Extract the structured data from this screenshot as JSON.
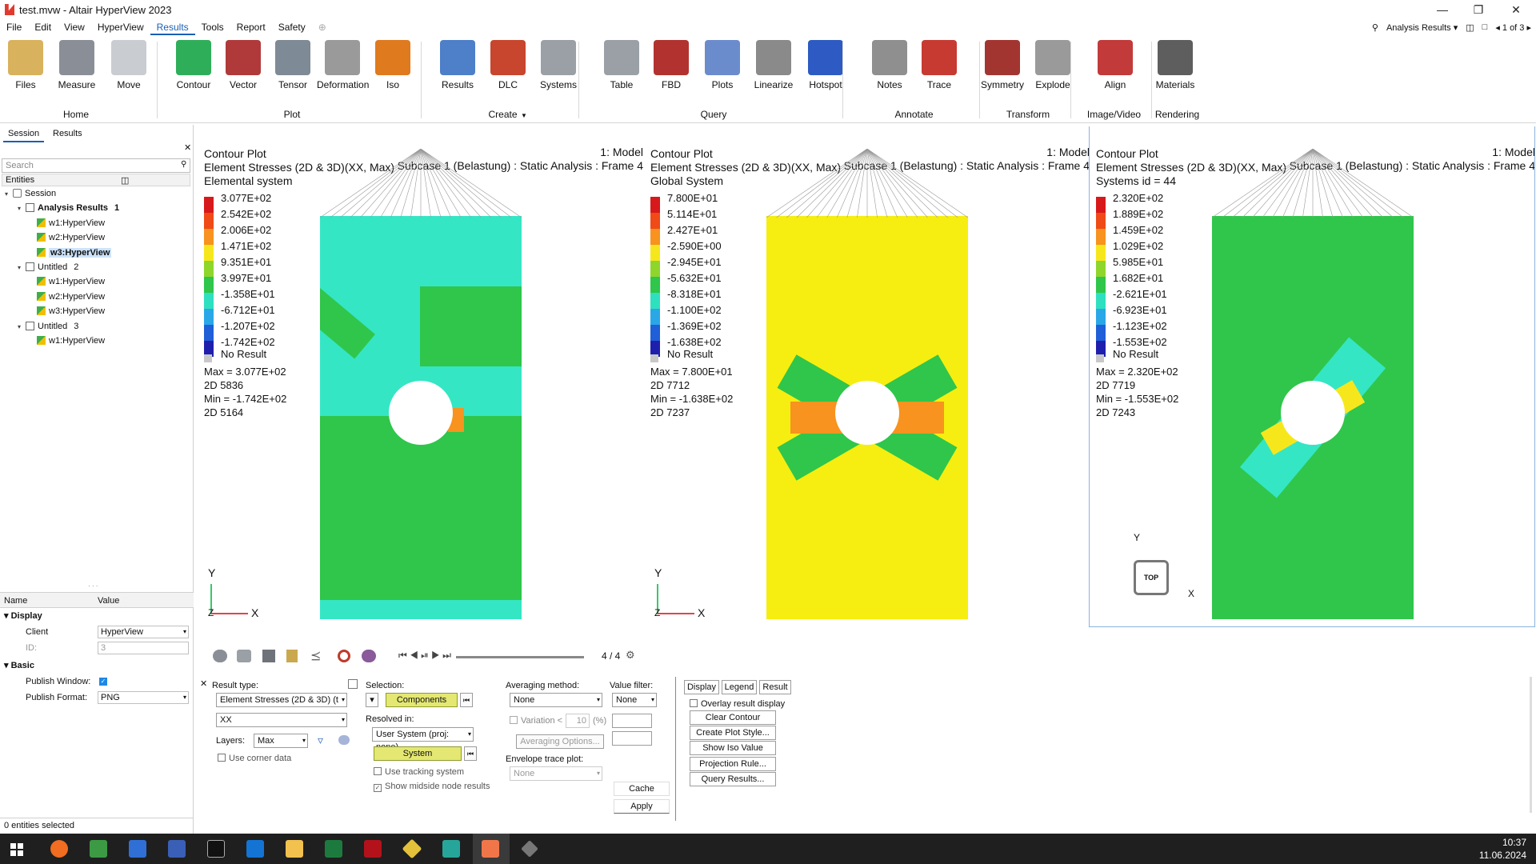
{
  "window": {
    "title": "test.mvw - Altair HyperView 2023"
  },
  "menu": [
    "File",
    "Edit",
    "View",
    "HyperView",
    "Results",
    "Tools",
    "Report",
    "Safety"
  ],
  "menu_active": "Results",
  "menu_right": {
    "page_select": "Analysis Results",
    "page_count": "1 of 3"
  },
  "ribbon": {
    "tools": [
      {
        "label": "Files",
        "icon": "folder-icon",
        "color": "#d8b25c"
      },
      {
        "label": "Measure",
        "icon": "measure-icon",
        "color": "#8a8f97"
      },
      {
        "label": "Move",
        "icon": "move-icon",
        "color": "#c9ccd1"
      },
      {
        "label": "Contour",
        "icon": "contour-icon",
        "color": "#2fae5a"
      },
      {
        "label": "Vector",
        "icon": "vector-icon",
        "color": "#b03a3a"
      },
      {
        "label": "Tensor",
        "icon": "tensor-icon",
        "color": "#7e8a95"
      },
      {
        "label": "Deformation",
        "icon": "deformation-icon",
        "color": "#9a9a9a"
      },
      {
        "label": "Iso",
        "icon": "iso-icon",
        "color": "#e07a1e"
      },
      {
        "label": "Results",
        "icon": "results-icon",
        "color": "#4e7fc9"
      },
      {
        "label": "DLC",
        "icon": "dlc-icon",
        "color": "#c7462d"
      },
      {
        "label": "Systems",
        "icon": "systems-icon",
        "color": "#9aa0a6"
      },
      {
        "label": "Table",
        "icon": "table-icon",
        "color": "#9aa0a6"
      },
      {
        "label": "FBD",
        "icon": "fbd-icon",
        "color": "#b2322f"
      },
      {
        "label": "Plots",
        "icon": "plots-icon",
        "color": "#6b8ccc"
      },
      {
        "label": "Linearize",
        "icon": "linearize-icon",
        "color": "#8a8a8a"
      },
      {
        "label": "Hotspot",
        "icon": "hotspot-icon",
        "color": "#2d5bc3"
      },
      {
        "label": "Notes",
        "icon": "notes-icon",
        "color": "#8f8f8f"
      },
      {
        "label": "Trace",
        "icon": "trace-icon",
        "color": "#c73a32"
      },
      {
        "label": "Symmetry",
        "icon": "symmetry-icon",
        "color": "#a33530"
      },
      {
        "label": "Explode",
        "icon": "explode-icon",
        "color": "#9a9a9a"
      },
      {
        "label": "Align",
        "icon": "align-icon",
        "color": "#c23a3a"
      },
      {
        "label": "Materials",
        "icon": "materials-icon",
        "color": "#5e5e5e"
      }
    ],
    "groups": [
      "Home",
      "Plot",
      "Create",
      "Query",
      "Annotate",
      "Transform",
      "Image/Video",
      "Rendering"
    ]
  },
  "left": {
    "tabs": [
      "Session",
      "Results"
    ],
    "search_placeholder": "Search",
    "entities_label": "Entities",
    "tree": [
      {
        "label": "Session",
        "count": ""
      },
      {
        "label": "Analysis Results",
        "count": "1"
      },
      {
        "label": "w1:HyperView",
        "count": ""
      },
      {
        "label": "w2:HyperView",
        "count": ""
      },
      {
        "label": "w3:HyperView",
        "count": ""
      },
      {
        "label": "Untitled",
        "count": "2"
      },
      {
        "label": "w1:HyperView",
        "count": ""
      },
      {
        "label": "w2:HyperView",
        "count": ""
      },
      {
        "label": "w3:HyperView",
        "count": ""
      },
      {
        "label": "Untitled",
        "count": "3"
      },
      {
        "label": "w1:HyperView",
        "count": ""
      }
    ],
    "props": {
      "name_hdr": "Name",
      "value_hdr": "Value",
      "display": "Display",
      "client_lbl": "Client",
      "client_val": "HyperView",
      "id_lbl": "ID:",
      "id_val": "3",
      "basic": "Basic",
      "publish_window": "Publish Window:",
      "publish_format": "Publish Format:",
      "format_val": "PNG"
    },
    "status": "0 entities selected"
  },
  "viewports": [
    {
      "title": "Contour Plot",
      "subtitle": "Element Stresses (2D & 3D)(XX, Max)",
      "system": "Elemental system",
      "model": "1: Model",
      "subcase": "Subcase 1 (Belastung) : Static Analysis : Frame 4",
      "legend": [
        "3.077E+02",
        "2.542E+02",
        "2.006E+02",
        "1.471E+02",
        "9.351E+01",
        "3.997E+01",
        "-1.358E+01",
        "-6.712E+01",
        "-1.207E+02",
        "-1.742E+02"
      ],
      "no_result": "No Result",
      "max": "Max = 3.077E+02",
      "max_el": "2D 5836",
      "min": "Min = -1.742E+02",
      "min_el": "2D 5164"
    },
    {
      "title": "Contour Plot",
      "subtitle": "Element Stresses (2D & 3D)(XX, Max)",
      "system": "Global System",
      "model": "1: Model",
      "subcase": "Subcase 1 (Belastung) : Static Analysis : Frame 4",
      "legend": [
        "7.800E+01",
        "5.114E+01",
        "2.427E+01",
        "-2.590E+00",
        "-2.945E+01",
        "-5.632E+01",
        "-8.318E+01",
        "-1.100E+02",
        "-1.369E+02",
        "-1.638E+02"
      ],
      "no_result": "No Result",
      "max": "Max = 7.800E+01",
      "max_el": "2D 7712",
      "min": "Min = -1.638E+02",
      "min_el": "2D 7237"
    },
    {
      "title": "Contour Plot",
      "subtitle": "Element Stresses (2D & 3D)(XX, Max)",
      "system": "Systems id = 44",
      "model": "1: Model",
      "subcase": "Subcase 1 (Belastung) : Static Analysis : Frame 4",
      "legend": [
        "2.320E+02",
        "1.889E+02",
        "1.459E+02",
        "1.029E+02",
        "5.985E+01",
        "1.682E+01",
        "-2.621E+01",
        "-6.923E+01",
        "-1.123E+02",
        "-1.553E+02"
      ],
      "no_result": "No Result",
      "max": "Max = 2.320E+02",
      "max_el": "2D 7719",
      "min": "Min = -1.553E+02",
      "min_el": "2D 7243"
    }
  ],
  "axes": {
    "y": "Y",
    "x": "X",
    "z": "Z",
    "top": "TOP"
  },
  "legend_colors": [
    "#d7191c",
    "#f04a17",
    "#f7931e",
    "#f6e71d",
    "#8ed62b",
    "#2fc64b",
    "#2ee0c0",
    "#2aa7e7",
    "#1f5fd8",
    "#1f1fae"
  ],
  "animation": {
    "frame": "4 / 4"
  },
  "bottom": {
    "result_type_lbl": "Result type:",
    "result_type": "Element Stresses (2D & 3D) (t",
    "component": "XX",
    "layers_lbl": "Layers:",
    "layers_val": "Max",
    "corner": "Use corner data",
    "selection_lbl": "Selection:",
    "components_btn": "Components",
    "resolved_lbl": "Resolved in:",
    "resolved_val": "User System (proj: none)",
    "system_btn": "System",
    "tracking": "Use tracking system",
    "midside": "Show midside node results",
    "averaging_lbl": "Averaging method:",
    "averaging_val": "None",
    "variation": "Variation <",
    "variation_val": "10",
    "pct": "(%)",
    "avg_options": "Averaging Options...",
    "envelope_lbl": "Envelope trace plot:",
    "envelope_val": "None",
    "value_filter_lbl": "Value filter:",
    "value_filter_val": "None",
    "cache": "Cache",
    "apply": "Apply",
    "tabs": [
      "Display",
      "Legend",
      "Result"
    ],
    "overlay": "Overlay result display",
    "buttons": [
      "Clear Contour",
      "Create Plot Style...",
      "Show Iso Value",
      "Projection Rule...",
      "Query Results..."
    ]
  },
  "taskbar": {
    "time": "10:37",
    "date": "11.06.2024"
  }
}
